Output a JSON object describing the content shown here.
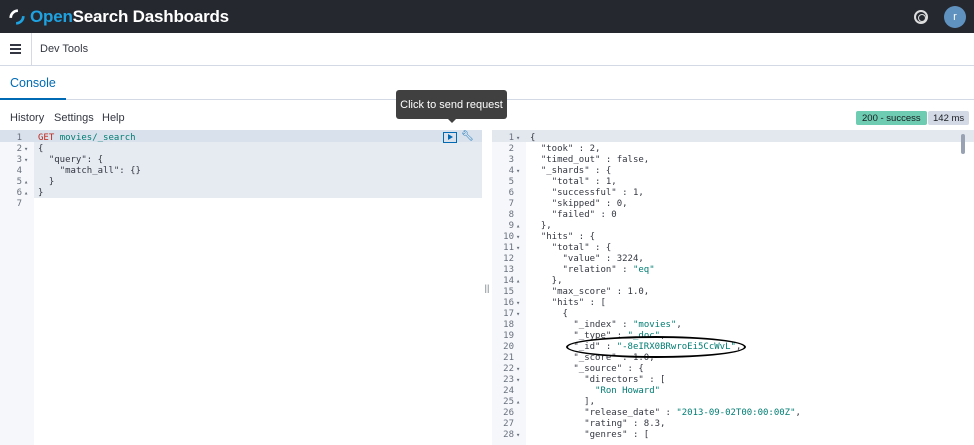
{
  "header": {
    "logo_text_a": "Open",
    "logo_text_b": "Search Dashboards",
    "avatar_initial": "r"
  },
  "appbar": {
    "breadcrumb": "Dev Tools"
  },
  "tabs": {
    "console": "Console"
  },
  "toolbar": {
    "history": "History",
    "settings": "Settings",
    "help": "Help",
    "status": "200 - success",
    "time": "142 ms"
  },
  "tooltip": "Click to send request",
  "request": {
    "lines": [
      {
        "n": "1",
        "fold": "",
        "text": "GET movies/_search"
      },
      {
        "n": "2",
        "fold": "▾",
        "text": "{"
      },
      {
        "n": "3",
        "fold": "▾",
        "text": "  \"query\": {"
      },
      {
        "n": "4",
        "fold": "",
        "text": "    \"match_all\": {}"
      },
      {
        "n": "5",
        "fold": "▴",
        "text": "  }"
      },
      {
        "n": "6",
        "fold": "▴",
        "text": "}"
      },
      {
        "n": "7",
        "fold": "",
        "text": ""
      }
    ]
  },
  "response": {
    "lines": [
      {
        "n": "1",
        "fold": "▾",
        "text": "{"
      },
      {
        "n": "2",
        "fold": "",
        "text": "  \"took\" : 2,"
      },
      {
        "n": "3",
        "fold": "",
        "text": "  \"timed_out\" : false,"
      },
      {
        "n": "4",
        "fold": "▾",
        "text": "  \"_shards\" : {"
      },
      {
        "n": "5",
        "fold": "",
        "text": "    \"total\" : 1,"
      },
      {
        "n": "6",
        "fold": "",
        "text": "    \"successful\" : 1,"
      },
      {
        "n": "7",
        "fold": "",
        "text": "    \"skipped\" : 0,"
      },
      {
        "n": "8",
        "fold": "",
        "text": "    \"failed\" : 0"
      },
      {
        "n": "9",
        "fold": "▴",
        "text": "  },"
      },
      {
        "n": "10",
        "fold": "▾",
        "text": "  \"hits\" : {"
      },
      {
        "n": "11",
        "fold": "▾",
        "text": "    \"total\" : {"
      },
      {
        "n": "12",
        "fold": "",
        "text": "      \"value\" : 3224,"
      },
      {
        "n": "13",
        "fold": "",
        "text": "      \"relation\" : \"eq\""
      },
      {
        "n": "14",
        "fold": "▴",
        "text": "    },"
      },
      {
        "n": "15",
        "fold": "",
        "text": "    \"max_score\" : 1.0,"
      },
      {
        "n": "16",
        "fold": "▾",
        "text": "    \"hits\" : ["
      },
      {
        "n": "17",
        "fold": "▾",
        "text": "      {"
      },
      {
        "n": "18",
        "fold": "",
        "text": "        \"_index\" : \"movies\","
      },
      {
        "n": "19",
        "fold": "",
        "text": "        \"_type\" : \"_doc\","
      },
      {
        "n": "20",
        "fold": "",
        "text": "        \"_id\" : \"-8eIRX0BRwroEi5CcWvL\","
      },
      {
        "n": "21",
        "fold": "",
        "text": "        \"_score\" : 1.0,"
      },
      {
        "n": "22",
        "fold": "▾",
        "text": "        \"_source\" : {"
      },
      {
        "n": "23",
        "fold": "▾",
        "text": "          \"directors\" : ["
      },
      {
        "n": "24",
        "fold": "",
        "text": "            \"Ron Howard\""
      },
      {
        "n": "25",
        "fold": "▴",
        "text": "          ],"
      },
      {
        "n": "26",
        "fold": "",
        "text": "          \"release_date\" : \"2013-09-02T00:00:00Z\","
      },
      {
        "n": "27",
        "fold": "",
        "text": "          \"rating\" : 8.3,"
      },
      {
        "n": "28",
        "fold": "▾",
        "text": "          \"genres\" : ["
      }
    ]
  },
  "colors": {
    "header_bg": "#25282f",
    "accent": "#006bb4",
    "success": "#6dccb1"
  }
}
